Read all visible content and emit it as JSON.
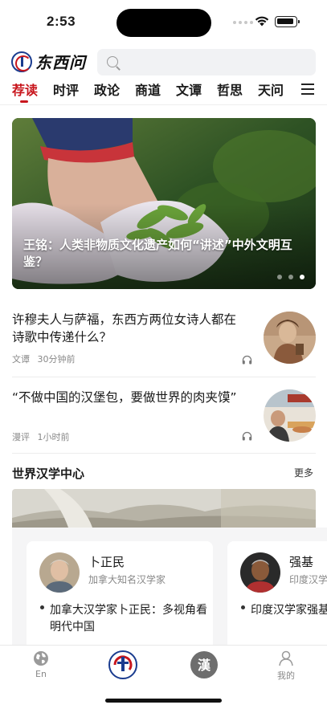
{
  "status_bar": {
    "time": "2:53"
  },
  "header": {
    "logo_text": "东西问",
    "search_placeholder": ""
  },
  "tabs": [
    {
      "label": "荐读",
      "active": true
    },
    {
      "label": "时评"
    },
    {
      "label": "政论"
    },
    {
      "label": "商道"
    },
    {
      "label": "文谭"
    },
    {
      "label": "哲思"
    },
    {
      "label": "天问"
    }
  ],
  "hero": {
    "caption": "王铭：人类非物质文化遗产如何“讲述”中外文明互鉴？",
    "slide_count": 3,
    "active_slide": 3
  },
  "articles": [
    {
      "title": "许穆夫人与萨福，东西方两位女诗人都在诗歌中传递什么？",
      "category": "文谭",
      "time": "30分钟前"
    },
    {
      "title": "“不做中国的汉堡包，要做世界的肉夹馍”",
      "category": "漫评",
      "time": "1小时前"
    }
  ],
  "section": {
    "title": "世界汉学中心",
    "more": "更多"
  },
  "scholars": [
    {
      "name": "卜正民",
      "description": "加拿大知名汉学家",
      "article": "加拿大汉学家卜正民：多视角看明代中国"
    },
    {
      "name": "强基",
      "description": "印度汉学家",
      "article": "印度汉学家强基：“以译传道”"
    }
  ],
  "bottom_nav": [
    {
      "label": "En",
      "icon": "globe-icon"
    },
    {
      "label": "",
      "icon": "logo-seal-icon"
    },
    {
      "label": "",
      "icon": "hanxue-seal-icon"
    },
    {
      "label": "我的",
      "icon": "user-icon"
    }
  ],
  "colors": {
    "accent": "#c8161d",
    "brand_blue": "#1a3c8f"
  }
}
